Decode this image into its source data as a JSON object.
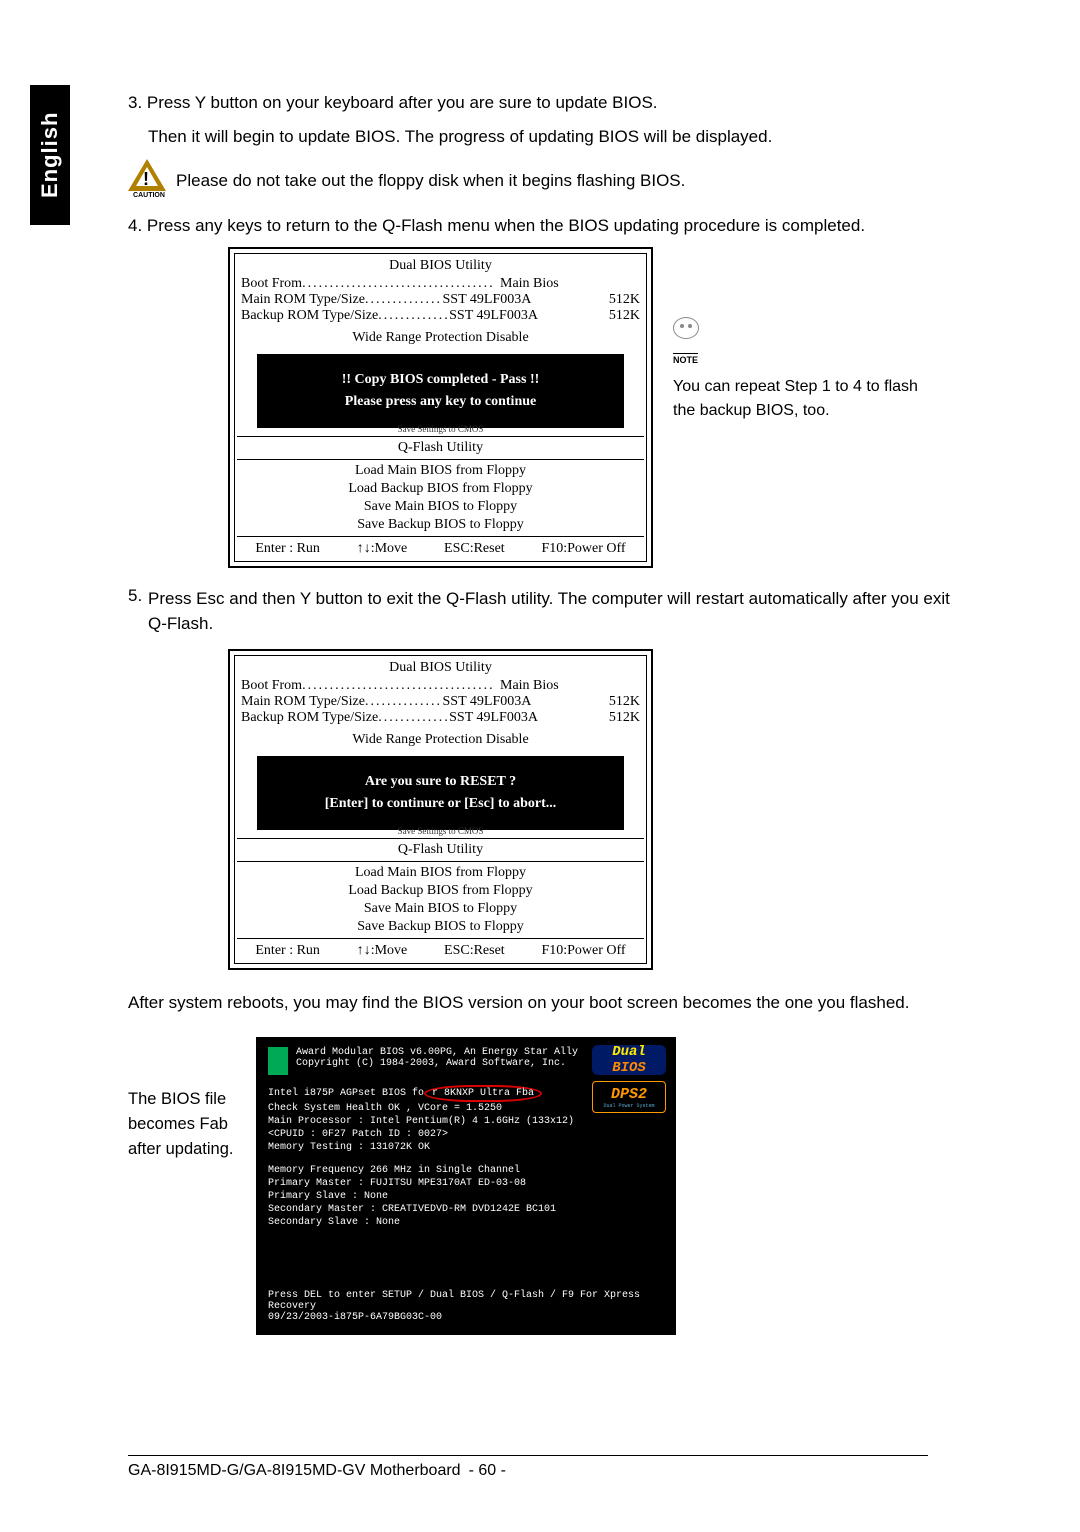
{
  "tab_label": "English",
  "step3_line1": "3. Press Y button on your keyboard after you are sure to update BIOS.",
  "step3_line2": "Then it will begin to update BIOS. The progress of updating BIOS will be displayed.",
  "caution_text": "Please do not take out the floppy disk when it begins flashing BIOS.",
  "caution_label": "CAUTION",
  "step4": "4. Press any keys to return to the Q-Flash menu when the BIOS updating procedure is completed.",
  "bios1": {
    "title": "Dual BIOS Utility",
    "boot_from_label": "Boot From",
    "boot_from_val": "Main Bios",
    "main_rom_label": "Main ROM Type/Size",
    "main_rom_val": "SST 49LF003A",
    "main_rom_size": "512K",
    "backup_rom_label": "Backup ROM Type/Size",
    "backup_rom_val": "SST 49LF003A",
    "backup_rom_size": "512K",
    "protection": "Wide Range Protection    Disable",
    "msg1": "!! Copy BIOS completed - Pass !!",
    "msg2": "Please press any key to continue",
    "hidden": "Save Settings to CMOS",
    "qflash": "Q-Flash Utility",
    "menu": [
      "Load Main BIOS from Floppy",
      "Load Backup BIOS from Floppy",
      "Save Main BIOS to Floppy",
      "Save Backup BIOS to Floppy"
    ],
    "foot": [
      "Enter : Run",
      "↑↓:Move",
      "ESC:Reset",
      "F10:Power Off"
    ]
  },
  "note_label": "NOTE",
  "side_note": "You can repeat Step 1 to 4 to flash the backup BIOS, too.",
  "step5_num": "5.",
  "step5_text": "Press Esc and then Y button to exit the Q-Flash utility. The computer will restart automatically after you exit Q-Flash.",
  "bios2": {
    "msg1": "Are you sure to RESET ?",
    "msg2": "[Enter] to continure or [Esc] to abort..."
  },
  "after_reboot": "After system reboots, you may find the BIOS version on your boot screen becomes the one you flashed.",
  "bios_note": "The BIOS file becomes Fab after updating.",
  "boot": {
    "hdr1": "Award Modular BIOS v6.00PG, An Energy Star Ally",
    "hdr2": "Copyright  (C) 1984-2003, Award Software,  Inc.",
    "l1a": "Intel i875P AGPset BIOS fo",
    "l1b": "r 8KNXP Ultra Fba",
    "l2": "Check System Health OK , VCore = 1.5250",
    "l3": "Main Processor : Intel Pentium(R) 4  1.6GHz (133x12)",
    "l4": "<CPUID : 0F27 Patch ID : 0027>",
    "l5": "Memory Testing  : 131072K OK",
    "l6": "Memory Frequency 266 MHz in Single Channel",
    "l7": "Primary Master : FUJITSU MPE3170AT ED-03-08",
    "l8": "Primary Slave : None",
    "l9": "Secondary Master : CREATIVEDVD-RM DVD1242E BC101",
    "l10": "Secondary Slave : None",
    "b1": "Press DEL to enter SETUP / Dual BIOS / Q-Flash / F9 For Xpress Recovery",
    "b2": "09/23/2003-i875P-6A79BG03C-00"
  },
  "dual_d": "Dual",
  "dual_b": "BIOS",
  "dps": "DPS2",
  "dps_sub": "Dual Power System",
  "footer_model": "GA-8I915MD-G/GA-8I915MD-GV Motherboard",
  "footer_page": "- 60 -"
}
